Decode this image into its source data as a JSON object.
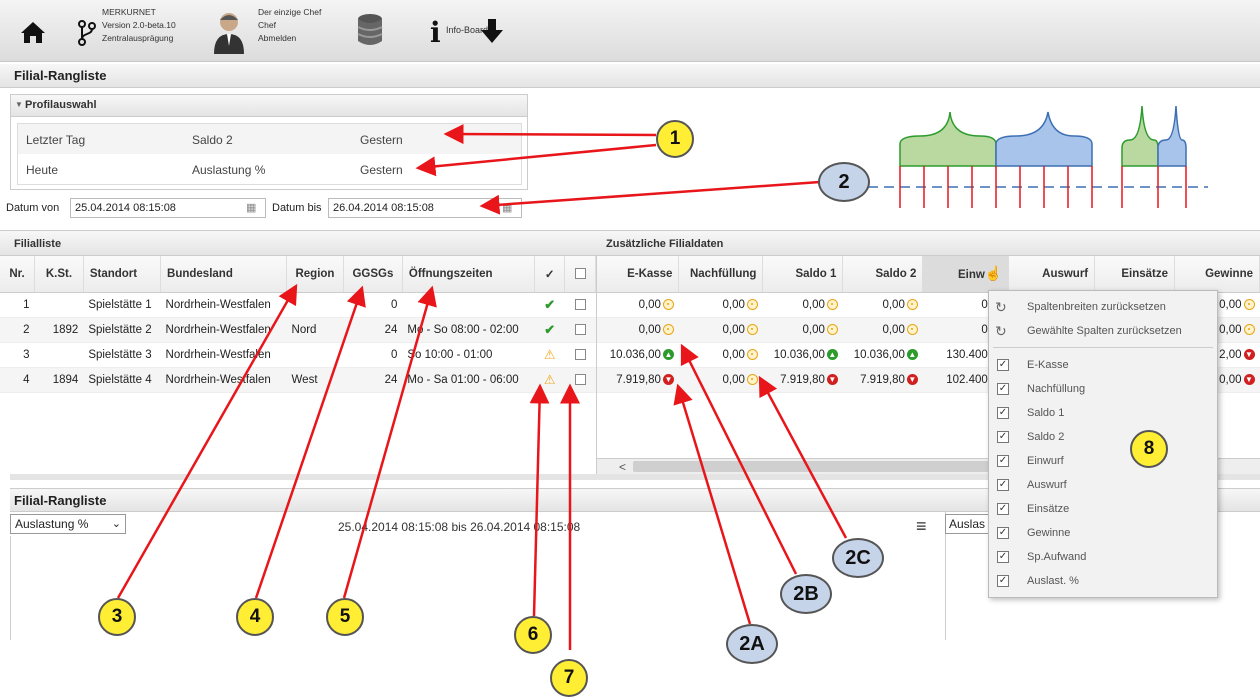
{
  "topbar": {
    "app_name": "MERKURNET",
    "version": "Version 2.0-beta.10",
    "variant": "Zentralausprägung",
    "user_line1": "Der einzige Chef",
    "user_line2": "Chef",
    "logout": "Abmelden",
    "info_board": "Info-Board"
  },
  "page_title": "Filial-Rangliste",
  "profile": {
    "title": "Profilauswahl",
    "rows": [
      {
        "a": "Letzter Tag",
        "b": "Saldo 2",
        "c": "Gestern"
      },
      {
        "a": "Heute",
        "b": "Auslastung %",
        "c": "Gestern"
      }
    ]
  },
  "dates": {
    "from_label": "Datum von",
    "from_value": "25.04.2014 08:15:08",
    "to_label": "Datum bis",
    "to_value": "26.04.2014 08:15:08"
  },
  "filialliste": {
    "title": "Filialliste",
    "columns": [
      "Nr.",
      "K.St.",
      "Standort",
      "Bundesland",
      "Region",
      "GGSGs",
      "Öffnungszeiten",
      "✓",
      ""
    ],
    "rows": [
      {
        "nr": "1",
        "kst": "",
        "standort": "Spielstätte 1",
        "bundesland": "Nordrhein-Westfalen",
        "region": "",
        "ggsgs": "0",
        "oeffnung": "",
        "status": "check"
      },
      {
        "nr": "2",
        "kst": "1892",
        "standort": "Spielstätte 2",
        "bundesland": "Nordrhein-Westfalen",
        "region": "Nord",
        "ggsgs": "24",
        "oeffnung": "Mo - So 08:00 - 02:00",
        "status": "check"
      },
      {
        "nr": "3",
        "kst": "",
        "standort": "Spielstätte 3",
        "bundesland": "Nordrhein-Westfalen",
        "region": "",
        "ggsgs": "0",
        "oeffnung": "So 10:00 - 01:00",
        "status": "warn"
      },
      {
        "nr": "4",
        "kst": "1894",
        "standort": "Spielstätte 4",
        "bundesland": "Nordrhein-Westfalen",
        "region": "West",
        "ggsgs": "24",
        "oeffnung": "Mo - Sa 01:00 - 06:00",
        "status": "warn"
      }
    ]
  },
  "zusatz": {
    "title": "Zusätzliche Filialdaten",
    "columns": [
      "E-Kasse",
      "Nachfüllung",
      "Saldo 1",
      "Saldo 2",
      "Einw",
      "Auswurf",
      "Einsätze",
      "Gewinne"
    ],
    "rows": [
      {
        "ekasse": "0,00",
        "ek_icon": "coin",
        "nach": "0,00",
        "s1": "0,00",
        "s1_icon": "coin",
        "s2": "0,00",
        "s2_icon": "coin",
        "einw": "0,00",
        "gew": "0,00",
        "gew_icon": "coin"
      },
      {
        "ekasse": "0,00",
        "ek_icon": "coin",
        "nach": "0,00",
        "s1": "0,00",
        "s1_icon": "coin",
        "s2": "0,00",
        "s2_icon": "coin",
        "einw": "0,00",
        "gew": "0,00",
        "gew_icon": "coin"
      },
      {
        "ekasse": "10.036,00",
        "ek_icon": "up",
        "nach": "0,00",
        "s1": "10.036,00",
        "s1_icon": "up",
        "s2": "10.036,00",
        "s2_icon": "up",
        "einw": "130.400,00",
        "gew": "2,00",
        "gew_icon": "down"
      },
      {
        "ekasse": "7.919,80",
        "ek_icon": "down",
        "nach": "0,00",
        "s1": "7.919,80",
        "s1_icon": "down",
        "s2": "7.919,80",
        "s2_icon": "down",
        "einw": "102.400,00",
        "gew": "0,00",
        "gew_icon": "down"
      }
    ]
  },
  "column_menu": {
    "reset_widths": "Spaltenbreiten zurücksetzen",
    "reset_selected": "Gewählte Spalten zurücksetzen",
    "items": [
      "E-Kasse",
      "Nachfüllung",
      "Saldo 1",
      "Saldo 2",
      "Einwurf",
      "Auswurf",
      "Einsätze",
      "Gewinne",
      "Sp.Aufwand",
      "Auslast. %"
    ]
  },
  "bottom": {
    "title": "Filial-Rangliste",
    "select_value": "Auslastung %",
    "range_text": "25.04.2014 08:15:08 bis 26.04.2014 08:15:08",
    "right_select": "Auslas"
  },
  "callouts": {
    "c1": "1",
    "c2": "2",
    "c3": "3",
    "c4": "4",
    "c5": "5",
    "c6": "6",
    "c7": "7",
    "c8": "8",
    "c2a": "2A",
    "c2b": "2B",
    "c2c": "2C"
  },
  "colors": {
    "arrow": "#e8161b",
    "callout_yellow": "#ffee33",
    "callout_blue": "#c6d4ea",
    "curve_green": "#b9d9a0",
    "curve_blue": "#a9c4ea"
  }
}
